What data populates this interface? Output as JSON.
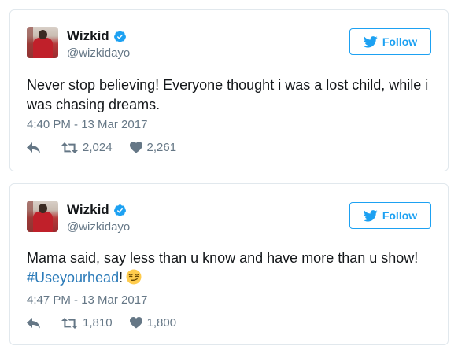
{
  "colors": {
    "accent": "#1da1f2",
    "hashtag": "#2b7bb9",
    "secondary_text": "#657786",
    "border": "#e1e8ed"
  },
  "tweets": [
    {
      "author": {
        "name": "Wizkid",
        "handle": "@wizkidayo",
        "verified_icon": "verified-badge-icon"
      },
      "follow_label": "Follow",
      "text": "Never stop believing! Everyone thought i was a lost child, while i was chasing dreams.",
      "timestamp": "4:40 PM - 13 Mar 2017",
      "retweets": "2,024",
      "likes": "2,261"
    },
    {
      "author": {
        "name": "Wizkid",
        "handle": "@wizkidayo",
        "verified_icon": "verified-badge-icon"
      },
      "follow_label": "Follow",
      "text": "Mama said, say less than u know and have more than u show!",
      "hashtag": "#Useyourhead",
      "suffix": "!",
      "emoji": "smirking-face-emoji",
      "timestamp": "4:47 PM - 13 Mar 2017",
      "retweets": "1,810",
      "likes": "1,800"
    }
  ]
}
